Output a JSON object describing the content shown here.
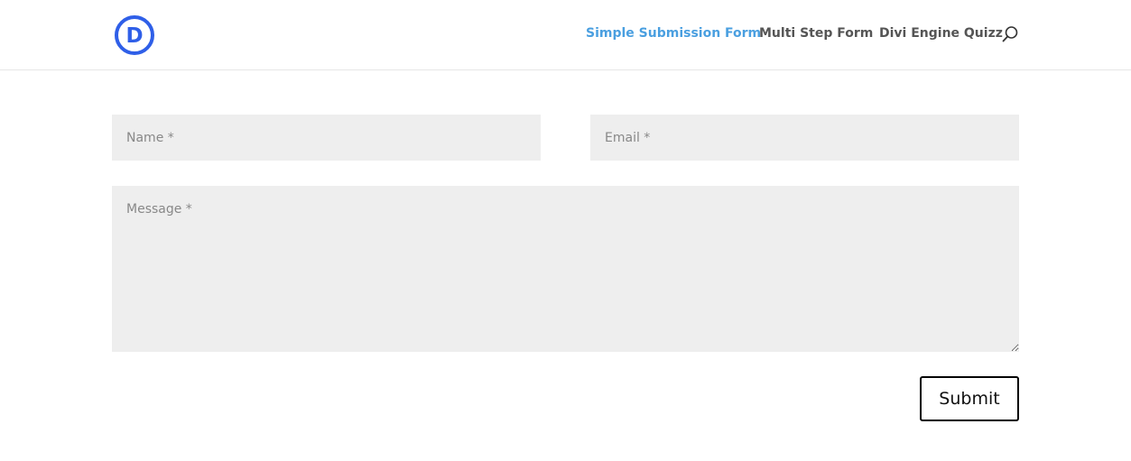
{
  "header": {
    "logo_letter": "D",
    "nav": [
      {
        "label": "Simple Submission Form",
        "active": true
      },
      {
        "label": "Multi Step Form",
        "active": false
      },
      {
        "label": "Divi Engine Quizz",
        "active": false
      }
    ],
    "search_icon": "search-icon"
  },
  "form": {
    "name_placeholder": "Name *",
    "email_placeholder": "Email *",
    "message_placeholder": "Message *",
    "submit_label": "Submit"
  },
  "colors": {
    "accent": "#4a9fe0",
    "logo": "#2f5fe8",
    "field_bg": "#eeeeee",
    "nav_text": "#555555"
  }
}
